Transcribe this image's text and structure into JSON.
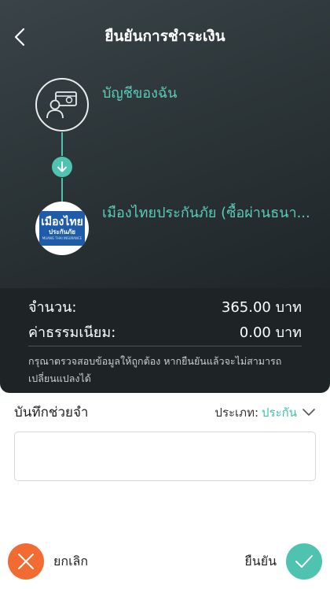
{
  "header": {
    "title": "ยืนยันการชำระเงิน",
    "back_icon": "chevron-left-icon"
  },
  "transfer": {
    "from_label": "บัญชีของฉัน",
    "from_icon": "account-card-icon",
    "to_label": "เมืองไทยประกันภัย (ซื้อผ่านธนา...",
    "to_logo": {
      "big_text": "เมืองไทย",
      "mid_text": "ประกันภัย",
      "small_text": "MUANG THAI INSURANCE"
    }
  },
  "summary": {
    "amount_label": "จำนวน:",
    "amount_value": "365.00 บาท",
    "fee_label": "ค่าธรรมเนียม:",
    "fee_value": "0.00 บาท",
    "notice": "กรุณาตรวจสอบข้อมูลให้ถูกต้อง หากยืนยันแล้วจะไม่สามารถเปลี่ยนแปลงได้"
  },
  "memo": {
    "label": "บันทึกช่วยจำ",
    "type_label": "ประเภท:",
    "type_value": "ประกัน",
    "input_value": ""
  },
  "actions": {
    "cancel_label": "ยกเลิก",
    "confirm_label": "ยืนยัน"
  },
  "colors": {
    "accent": "#4fc3b0",
    "cancel": "#f26b32",
    "header_bg": "#2c3538"
  }
}
